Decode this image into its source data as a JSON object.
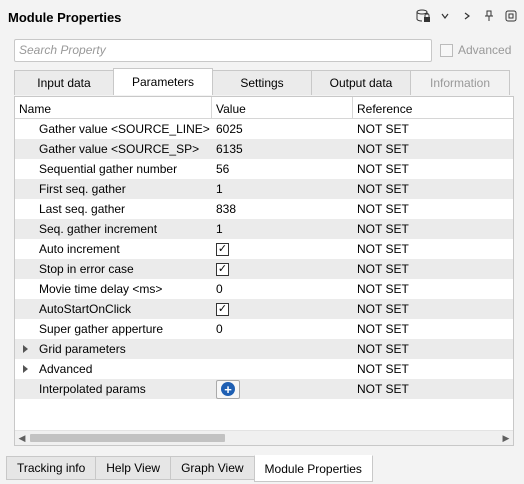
{
  "window": {
    "title": "Module Properties"
  },
  "toolbar_icons": [
    "database-lock-icon",
    "chevron-down-icon",
    "chevron-right-icon",
    "pin-icon",
    "float-window-icon"
  ],
  "search": {
    "placeholder": "Search Property",
    "value": ""
  },
  "advanced": {
    "label": "Advanced",
    "checked": false,
    "enabled": false
  },
  "tabs": [
    {
      "label": "Input data"
    },
    {
      "label": "Parameters"
    },
    {
      "label": "Settings"
    },
    {
      "label": "Output data"
    },
    {
      "label": "Information"
    }
  ],
  "table": {
    "headers": [
      "Name",
      "Value",
      "Reference"
    ],
    "rows": [
      {
        "name": "Gather value <SOURCE_LINE>",
        "value": "6025",
        "reference": "NOT SET"
      },
      {
        "name": "Gather value <SOURCE_SP>",
        "value": "6135",
        "reference": "NOT SET"
      },
      {
        "name": "Sequential gather number",
        "value": "56",
        "reference": "NOT SET"
      },
      {
        "name": "First seq. gather",
        "value": "1",
        "reference": "NOT SET"
      },
      {
        "name": "Last seq. gather",
        "value": "838",
        "reference": "NOT SET"
      },
      {
        "name": "Seq. gather increment",
        "value": "1",
        "reference": "NOT SET"
      },
      {
        "name": "Auto increment",
        "value": "✓",
        "reference": "NOT SET"
      },
      {
        "name": "Stop in error case",
        "value": "✓",
        "reference": "NOT SET"
      },
      {
        "name": "Movie time delay <ms>",
        "value": "0",
        "reference": "NOT SET"
      },
      {
        "name": "AutoStartOnClick",
        "value": "✓",
        "reference": "NOT SET"
      },
      {
        "name": "Super gather apperture",
        "value": "0",
        "reference": "NOT SET"
      },
      {
        "name": "Grid parameters",
        "value": "",
        "reference": "NOT SET"
      },
      {
        "name": "Advanced",
        "value": "",
        "reference": "NOT SET"
      },
      {
        "name": "Interpolated params",
        "value": "+",
        "reference": "NOT SET"
      }
    ]
  },
  "bottom_tabs": [
    {
      "label": "Tracking info"
    },
    {
      "label": "Help View"
    },
    {
      "label": "Graph View"
    },
    {
      "label": "Module Properties"
    }
  ]
}
